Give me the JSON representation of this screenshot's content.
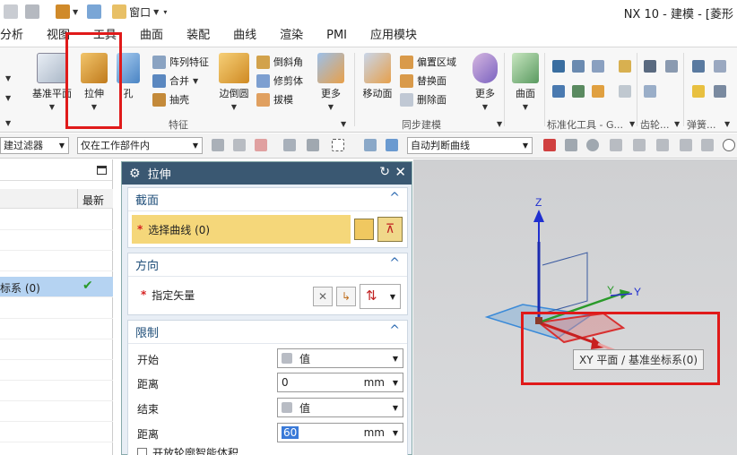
{
  "titlebar": {
    "window_menu": "窗口",
    "title": "NX 10 - 建模 - [菱形"
  },
  "tabs": [
    "分析",
    "视图",
    "工具",
    "曲面",
    "装配",
    "曲线",
    "渲染",
    "PMI",
    "应用模块"
  ],
  "ribbon": {
    "datum_plane": "基准平面",
    "extrude": "拉伸",
    "hole": "孔",
    "pattern_feature": "阵列特征",
    "unite": "合并",
    "shell": "抽壳",
    "edge_blend": "边倒圆",
    "chamfer": "倒斜角",
    "trim_body": "修剪体",
    "draft": "拔模",
    "more1": "更多",
    "feature_group": "特征",
    "move_face": "移动面",
    "offset_region": "偏置区域",
    "replace_face": "替换面",
    "delete_face": "删除面",
    "more2": "更多",
    "sync_group": "同步建模",
    "surface": "曲面",
    "std_tools_group": "标准化工具 - G...",
    "gear_group": "齿轮...",
    "spring_group": "弹簧..."
  },
  "selbar": {
    "filter": "建过滤器",
    "scope": "仅在工作部件内",
    "curve_rule": "自动判断曲线"
  },
  "navigator": {
    "col_latest": "最新",
    "selected_row": "标系 (0)"
  },
  "dialog": {
    "title": "拉伸",
    "section": {
      "header": "截面",
      "select_curve": "选择曲线 (0)"
    },
    "direction": {
      "header": "方向",
      "specify_vector": "指定矢量"
    },
    "limits": {
      "header": "限制",
      "start_label": "开始",
      "start_value": "值",
      "distance1_label": "距离",
      "distance1_value": "0",
      "distance1_unit": "mm",
      "end_label": "结束",
      "end_value": "值",
      "distance2_label": "距离",
      "distance2_value": "60",
      "distance2_unit": "mm",
      "open_profile": "开放轮廓智能体积"
    }
  },
  "graphics": {
    "axis_z": "Z",
    "axis_y": "Y",
    "axis_y2": "Y",
    "tooltip": "XY 平面 / 基准坐标系(0)"
  },
  "colors": {
    "dialog_title_bg": "#3a5872",
    "highlight_red": "#e01a1a",
    "section_yellow": "#f5d77a"
  }
}
